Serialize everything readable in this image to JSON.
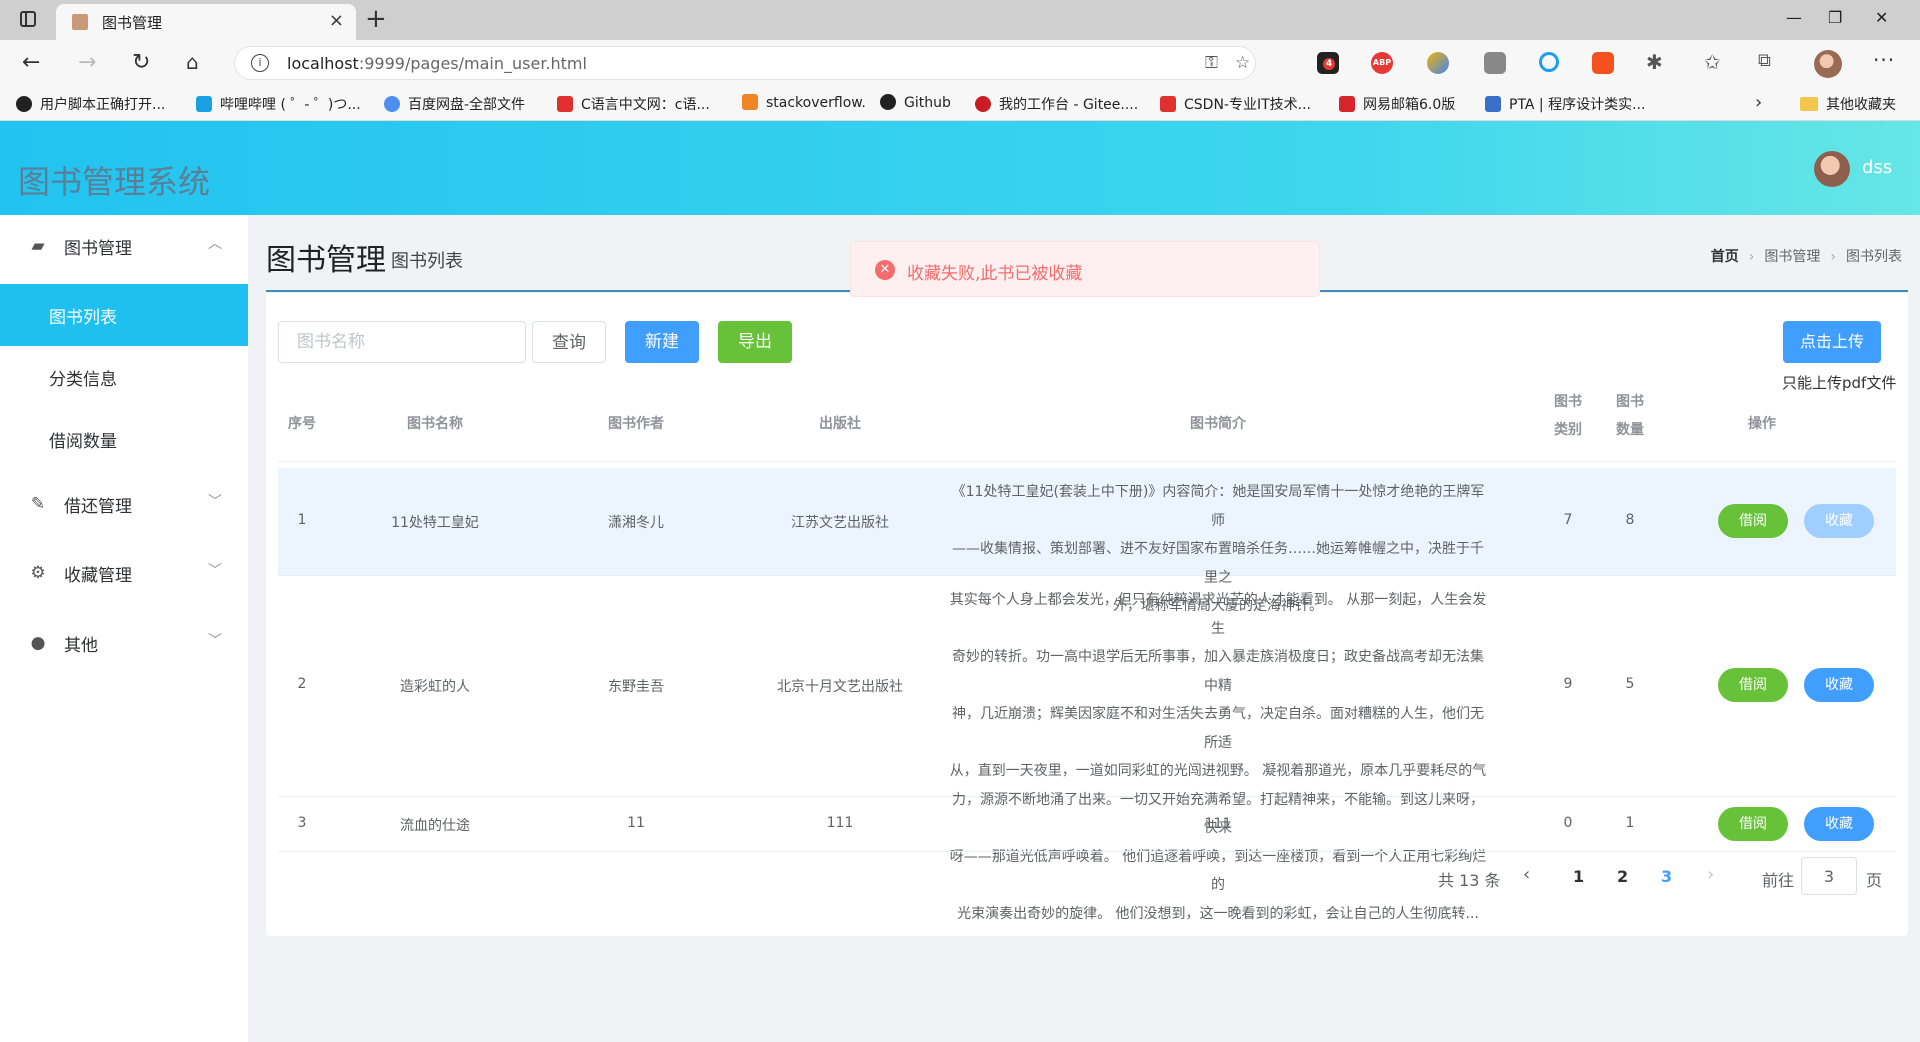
{
  "browser": {
    "tab_title": "图书管理",
    "tab_close": "×",
    "new_tab": "+",
    "window_controls": [
      "—",
      "❐",
      "✕"
    ],
    "url_host": "localhost",
    "url_rest": ":9999/pages/main_user.html",
    "ext_badge": "4",
    "ext_abp": "ABP",
    "more": "···",
    "bookmarks": [
      {
        "label": "用户脚本正确打开...",
        "color": "#222"
      },
      {
        "label": "哔哩哔哩 ( ゜- ゜)つ...",
        "color": "#1aa0e4"
      },
      {
        "label": "百度网盘-全部文件",
        "color": "#4a8ef2"
      },
      {
        "label": "C语言中文网：c语...",
        "color": "#e0312e"
      },
      {
        "label": "stackoverflow.",
        "color": "#f18426"
      },
      {
        "label": "Github",
        "color": "#222"
      },
      {
        "label": "我的工作台 - Gitee....",
        "color": "#c71d23"
      },
      {
        "label": "CSDN-专业IT技术...",
        "color": "#e0312e"
      },
      {
        "label": "网易邮箱6.0版",
        "color": "#d8252b"
      },
      {
        "label": "PTA | 程序设计类实...",
        "color": "#3b6fc6"
      }
    ],
    "bookmark_folder": "其他收藏夹"
  },
  "header": {
    "app_title": "图书管理系统",
    "user_name": "dss"
  },
  "sidebar": {
    "items": [
      {
        "label": "图书管理",
        "icon": "book-icon",
        "expanded": true
      },
      {
        "label": "借还管理",
        "icon": "pencil-icon",
        "expanded": false
      },
      {
        "label": "收藏管理",
        "icon": "gear-icon",
        "expanded": false
      },
      {
        "label": "其他",
        "icon": "palette-icon",
        "expanded": false
      }
    ],
    "sub_items": [
      "图书列表",
      "分类信息",
      "借阅数量"
    ]
  },
  "page": {
    "title": "图书管理",
    "subtitle": "图书列表",
    "breadcrumb": [
      "首页",
      "图书管理",
      "图书列表"
    ]
  },
  "toast": {
    "message": "收藏失败,此书已被收藏"
  },
  "toolbar": {
    "search_placeholder": "图书名称",
    "query_label": "查询",
    "new_label": "新建",
    "export_label": "导出",
    "upload_label": "点击上传",
    "upload_tip": "只能上传pdf文件"
  },
  "table": {
    "headers": {
      "index": "序号",
      "name": "图书名称",
      "author": "图书作者",
      "publisher": "出版社",
      "desc": "图书简介",
      "category_1": "图书",
      "category_2": "类别",
      "count_1": "图书",
      "count_2": "数量",
      "ops": "操作"
    },
    "borrow_label": "借阅",
    "fav_label": "收藏",
    "rows": [
      {
        "index": "1",
        "name": "11处特工皇妃",
        "author": "潇湘冬儿",
        "publisher": "江苏文艺出版社",
        "desc": [
          "《11处特工皇妃(套装上中下册)》内容简介：她是国安局军情十一处惊才绝艳的王牌军师",
          "——收集情报、策划部署、进不友好国家布置暗杀任务……她运筹帷幄之中，决胜于千里之",
          "外，堪称军情局大厦的定海神针。"
        ],
        "category": "7",
        "count": "8"
      },
      {
        "index": "2",
        "name": "造彩虹的人",
        "author": "东野圭吾",
        "publisher": "北京十月文艺出版社",
        "desc": [
          "其实每个人身上都会发光，但只有纯粹渴求光芒的人才能看到。 从那一刻起，人生会发生",
          "奇妙的转折。功一高中退学后无所事事，加入暴走族消极度日；政史备战高考却无法集中精",
          "神，几近崩溃；辉美因家庭不和对生活失去勇气，决定自杀。面对糟糕的人生，他们无所适",
          "从，直到一天夜里，一道如同彩虹的光闯进视野。 凝视着那道光，原本几乎要耗尽的气",
          "力，源源不断地涌了出来。一切又开始充满希望。打起精神来，不能输。到这儿来呀，快来",
          "呀——那道光低声呼唤着。 他们追逐着呼唤，到达一座楼顶，看到一个人正用七彩绚烂的",
          "光束演奏出奇妙的旋律。 他们没想到，这一晚看到的彩虹，会让自己的人生彻底转..."
        ],
        "category": "9",
        "count": "5"
      },
      {
        "index": "3",
        "name": "流血的仕途",
        "author": "11",
        "publisher": "111",
        "desc": [
          "111"
        ],
        "category": "0",
        "count": "1"
      }
    ]
  },
  "pagination": {
    "total": "共 13 条",
    "pages": [
      "1",
      "2",
      "3"
    ],
    "current_page": "3",
    "goto_label": "前往",
    "goto_value": "3",
    "page_unit": "页"
  }
}
